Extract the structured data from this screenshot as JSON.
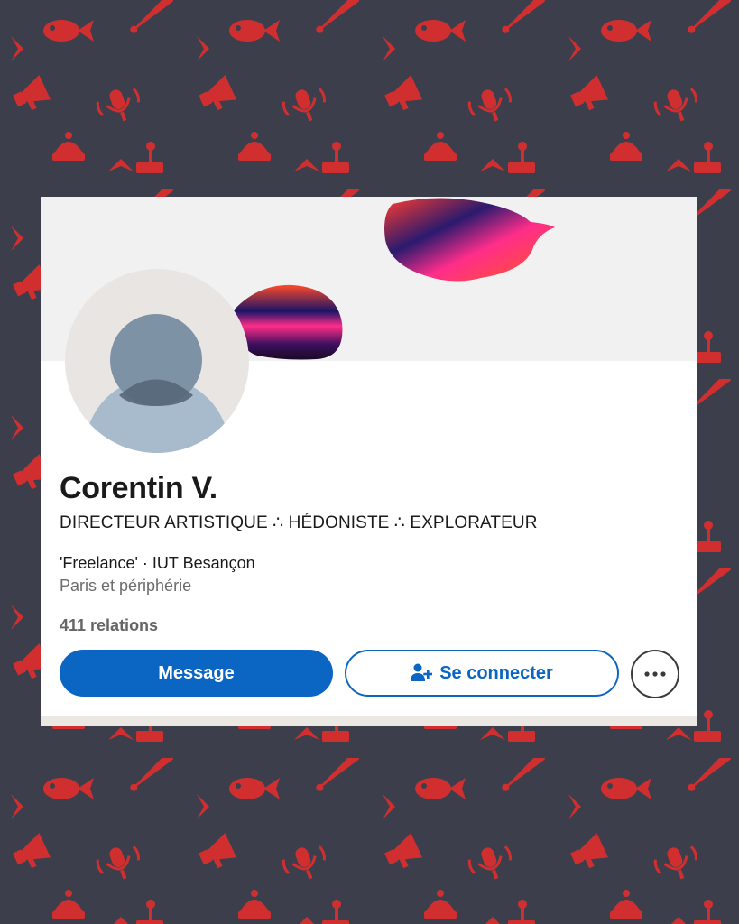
{
  "colors": {
    "background": "#3d3e4c",
    "pattern": "#d12f2f",
    "card": "#ffffff",
    "banner": "#f2f1f1",
    "primary": "#0a66c2",
    "avatar_bg": "#e8e5e2",
    "avatar_head": "#7e92a6",
    "avatar_body": "#a8bbcc"
  },
  "pattern_icons": [
    "megaphone-icon",
    "fish-icon",
    "microphone-icon",
    "baseball-bat-icon",
    "joystick-icon",
    "beanie-hat-icon"
  ],
  "profile": {
    "name": "Corentin V.",
    "headline": "DIRECTEUR ARTISTIQUE ∴ HÉDONISTE ∴ EXPLORATEUR",
    "experience": "'Freelance' · IUT Besançon",
    "location": "Paris et périphérie",
    "connections": "411 relations",
    "avatar_icon": "default-person-icon"
  },
  "actions": {
    "message_label": "Message",
    "connect_label": "Se connecter",
    "connect_icon": "person-add-icon",
    "more_icon": "more-dots-icon"
  }
}
